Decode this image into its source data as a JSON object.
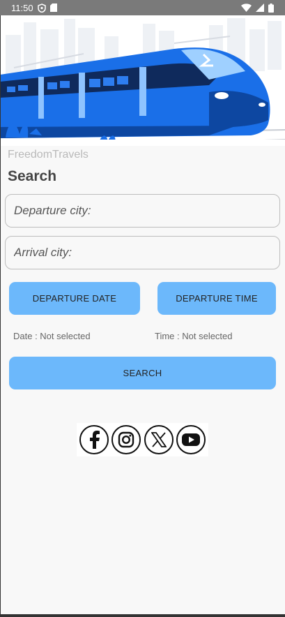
{
  "status_bar": {
    "time": "11:50",
    "icons_left": [
      "shield-icon",
      "sd-card-icon"
    ],
    "icons_right": [
      "wifi-icon",
      "signal-icon",
      "battery-icon"
    ]
  },
  "app": {
    "brand": "FreedomTravels",
    "title": "Search"
  },
  "form": {
    "departure_placeholder": "Departure city:",
    "arrival_placeholder": "Arrival city:",
    "departure_date_button": "DEPARTURE DATE",
    "departure_time_button": "DEPARTURE TIME",
    "date_status": "Date : Not selected",
    "time_status": "Time : Not selected",
    "search_button": "SEARCH"
  },
  "socials": [
    "facebook-icon",
    "instagram-icon",
    "x-icon",
    "youtube-icon"
  ],
  "colors": {
    "accent": "#6cb8fb",
    "train_blue": "#1a6fe8",
    "background": "#f8f8f8",
    "status_bar": "#7a7a7a"
  }
}
